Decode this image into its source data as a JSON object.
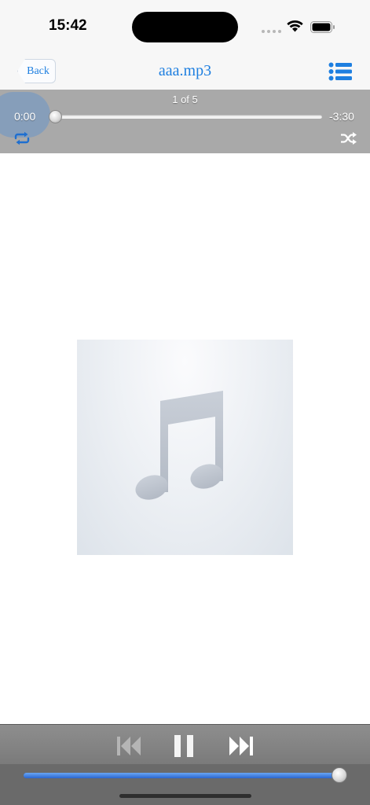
{
  "status_bar": {
    "time": "15:42",
    "icons": [
      "cellular-dots-icon",
      "wifi-icon",
      "battery-icon"
    ]
  },
  "nav": {
    "back_label": "Back",
    "title": "aaa.mp3",
    "menu_icon": "list-icon",
    "accent_color": "#1e7fe0"
  },
  "player": {
    "track_position": "1 of 5",
    "elapsed": "0:00",
    "remaining": "-3:30",
    "progress_fraction": 0.0,
    "repeat_icon": "repeat-icon",
    "shuffle_icon": "shuffle-icon"
  },
  "artwork": {
    "placeholder_icon": "music-note-icon"
  },
  "controls": {
    "previous_icon": "skip-previous-icon",
    "pause_icon": "pause-icon",
    "next_icon": "skip-next-icon",
    "volume_fraction": 1.0,
    "volume_color": "#2f6fd6"
  }
}
